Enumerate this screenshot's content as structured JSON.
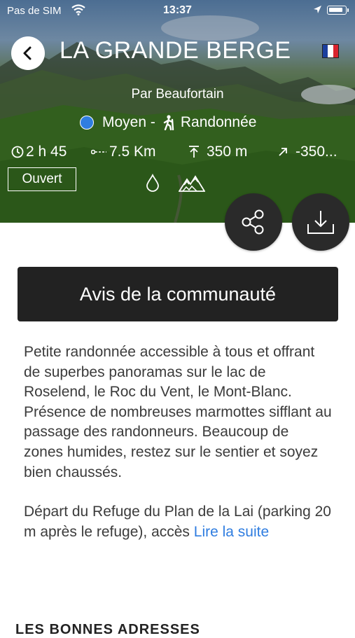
{
  "status_bar": {
    "carrier": "Pas de SIM",
    "time": "13:37"
  },
  "header": {
    "title": "LA GRANDE BERGE",
    "author": "Par Beaufortain",
    "difficulty": "Moyen -",
    "activity": "Randonnée",
    "language_flag": {
      "name": "french-flag",
      "colors": [
        "#1c3f9e",
        "#ffffff",
        "#d9232e"
      ]
    }
  },
  "stats": {
    "duration": "2 h 45",
    "distance": "7.5 Km",
    "ascent": "350 m",
    "descent": "-350..."
  },
  "badges": {
    "status": "Ouvert"
  },
  "icons": [
    "back-icon",
    "clock-icon",
    "distance-icon",
    "ascent-icon",
    "descent-icon",
    "hiker-icon",
    "water-drop-icon",
    "mountain-icon",
    "share-icon",
    "download-icon"
  ],
  "community_button": "Avis de la communauté",
  "description": {
    "paragraph1": "Petite randonnée accessible à tous et offrant de superbes panoramas sur le lac de Roselend, le Roc du Vent, le Mont-Blanc. Présence de nombreuses marmottes sifflant au passage des randonneurs. Beaucoup de zones humides, restez sur le sentier et soyez bien chaussés.",
    "paragraph2": "Départ du Refuge du Plan de la Lai (parking 20 m après le refuge), accès",
    "read_more": "Lire la suite"
  },
  "next_section": {
    "title": "LES BONNES ADRESSES"
  },
  "colors": {
    "accent": "#2f7de0",
    "dark_button": "#222222",
    "fab": "#2a2a2a",
    "difficulty_dot": "#2f7de0"
  }
}
